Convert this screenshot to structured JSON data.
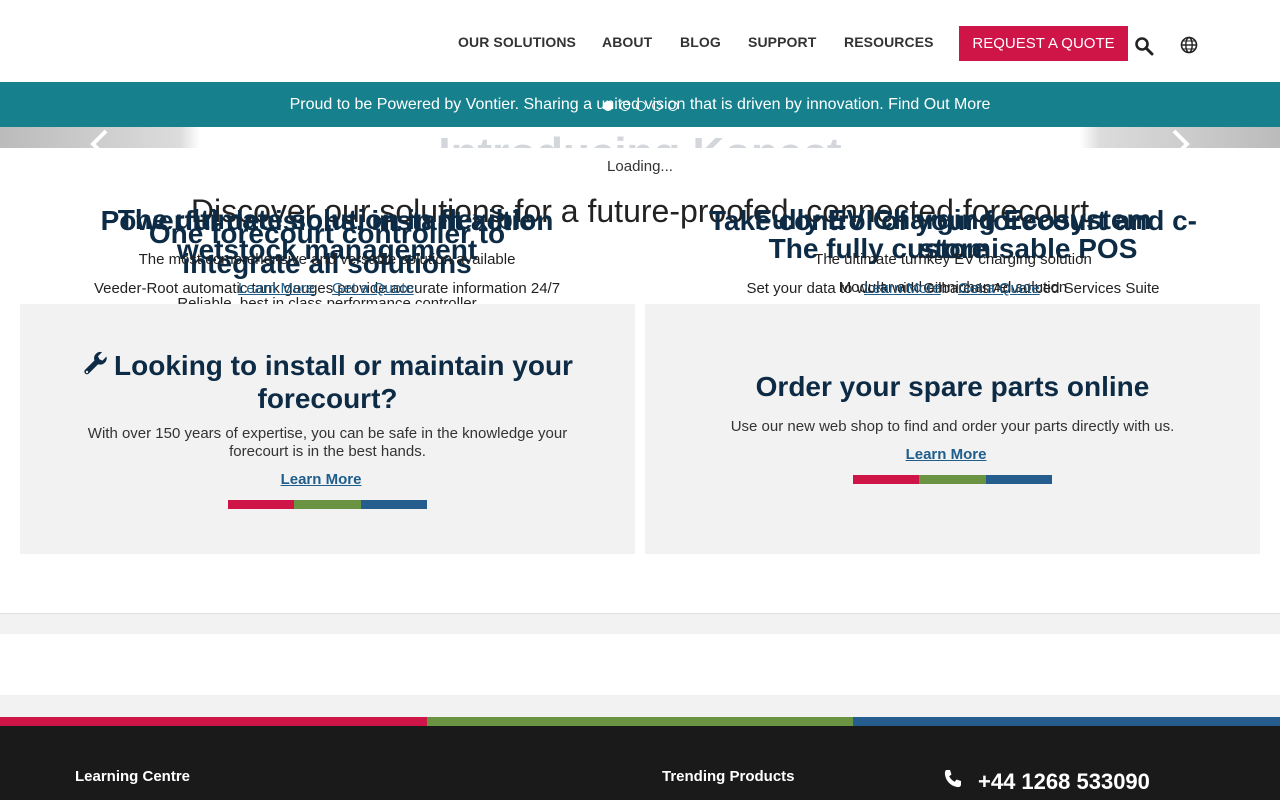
{
  "header": {
    "nav": [
      "OUR SOLUTIONS",
      "ABOUT",
      "BLOG",
      "SUPPORT",
      "RESOURCES"
    ],
    "quote_label": "REQUEST A QUOTE",
    "icons": [
      "search-icon",
      "globe-icon"
    ]
  },
  "announcement": {
    "text": "Proud to be Powered by Vontier. Sharing a united vision that is driven by innovation.",
    "link": "Find Out More"
  },
  "carousel": {
    "ghost_title": "Introducing Konect",
    "loading": "Loading...",
    "discover": "Discover our solutions for a future-proofed, connected forecourt",
    "left": {
      "title_a": "The ultimate solution in flexible",
      "title_b": "wetstock management",
      "title_c": "Powerful decisions, instant action",
      "title_d": "One forecourt controller to",
      "title_e": "integrate all solutions",
      "sub_a": "The most comprehensive and versatile solution available",
      "sub_b": "Veeder-Root automatic tank gauges provide accurate information 24/7",
      "sub_c": "Reliable, best in class performance controller",
      "link_a": "Learn More",
      "link_b": "Get a Quote"
    },
    "right": {
      "title_a": "Fully EV Charging Ecosystem",
      "title_b": "The fully customisable POS",
      "title_c": "Take control of your forecourt and c-",
      "title_d": "store",
      "sub_a": "The ultimate turnkey EV charging solution",
      "sub_b": "Modular and omnichannel solution",
      "sub_c": "Set your data to work with Gilbarco's Advanced Services Suite",
      "link_a": "Learn More",
      "link_b": "Get a Quote"
    }
  },
  "cards": [
    {
      "title": "Looking to install or maintain your forecourt?",
      "text": "With over 150 years of expertise, you can be safe in the knowledge your forecourt is in the best hands.",
      "link": "Learn More",
      "icon": "wrench-icon"
    },
    {
      "title": "Order your spare parts online",
      "text": "Use our new web shop to find and order your parts directly with us.",
      "link": "Learn More"
    }
  ],
  "footer": {
    "col1": "Learning Centre",
    "col2": "Trending Products",
    "phone": "+44 1268 533090",
    "phone_icon": "phone-icon"
  },
  "colors": {
    "brand_red": "#cf1447",
    "brand_green": "#6a9441",
    "brand_blue": "#245d8e",
    "teal": "#16818c",
    "navy": "#0d2b45"
  }
}
